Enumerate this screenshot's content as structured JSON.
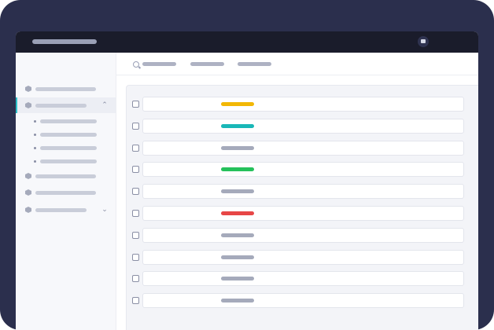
{
  "window": {
    "title": "",
    "app_icon": "image-icon"
  },
  "sidebar": {
    "items": [
      {
        "label": "",
        "icon": "hex-icon",
        "state": "collapsed"
      },
      {
        "label": "",
        "icon": "hex-icon",
        "state": "expanded",
        "chevron": "chevron-up-icon"
      },
      {
        "label": "",
        "icon": "hex-icon"
      },
      {
        "label": "",
        "icon": "hex-icon"
      },
      {
        "label": "",
        "icon": "hex-icon",
        "chevron": "chevron-down-icon"
      }
    ],
    "subitems": [
      "",
      "",
      "",
      ""
    ]
  },
  "topnav": {
    "search_icon": "search-icon",
    "tabs": [
      "",
      "",
      ""
    ]
  },
  "colors": {
    "accent": "#2cc1c9",
    "yellow": "#f2b705",
    "teal": "#19b7b7",
    "green": "#25c15b",
    "red": "#e74646",
    "neutral": "#a5aabb"
  },
  "table": {
    "rows": [
      {
        "status_color": "#f2b705"
      },
      {
        "status_color": "#19b7b7"
      },
      {
        "status_color": "#a5aabb"
      },
      {
        "status_color": "#25c15b"
      },
      {
        "status_color": "#a5aabb"
      },
      {
        "status_color": "#e74646"
      },
      {
        "status_color": "#a5aabb"
      },
      {
        "status_color": "#a5aabb"
      },
      {
        "status_color": "#a5aabb"
      },
      {
        "status_color": "#a5aabb"
      }
    ]
  }
}
